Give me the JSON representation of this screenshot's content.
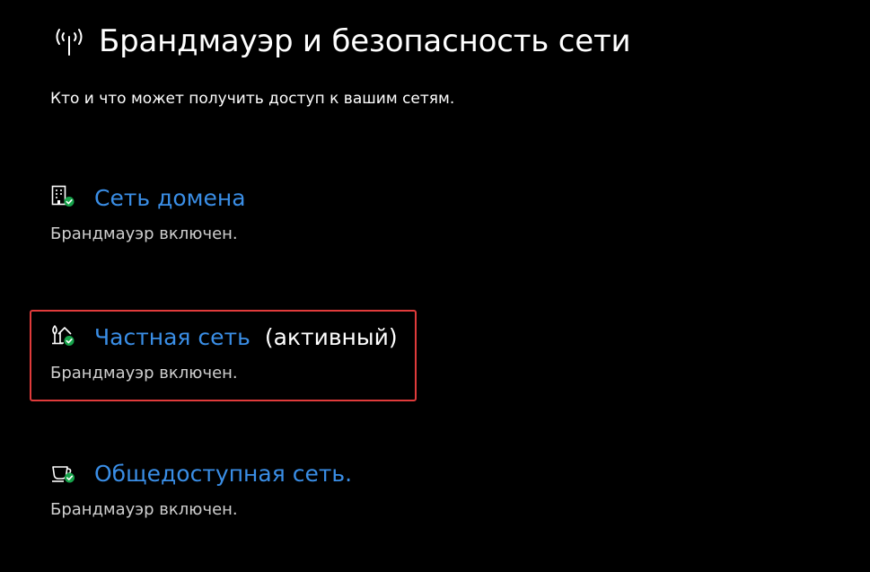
{
  "header": {
    "title": "Брандмауэр и безопасность сети",
    "subtitle": "Кто и что может получить доступ к вашим сетям.",
    "icon": "wifi-antenna-icon"
  },
  "colors": {
    "background": "#000000",
    "link": "#3a8ee6",
    "status_text": "#cfcfcf",
    "ok_badge": "#16a34a",
    "highlight_border": "#e03b3b"
  },
  "networks": [
    {
      "name": "Сеть домена",
      "badge": "",
      "status": "Брандмауэр включен.",
      "icon": "domain-building-icon"
    },
    {
      "name": "Частная сеть",
      "badge": "(активный)",
      "status": "Брандмауэр включен.",
      "icon": "private-home-icon"
    },
    {
      "name": "Общедоступная сеть.",
      "badge": "",
      "status": "Брандмауэр включен.",
      "icon": "public-cafe-icon"
    }
  ]
}
